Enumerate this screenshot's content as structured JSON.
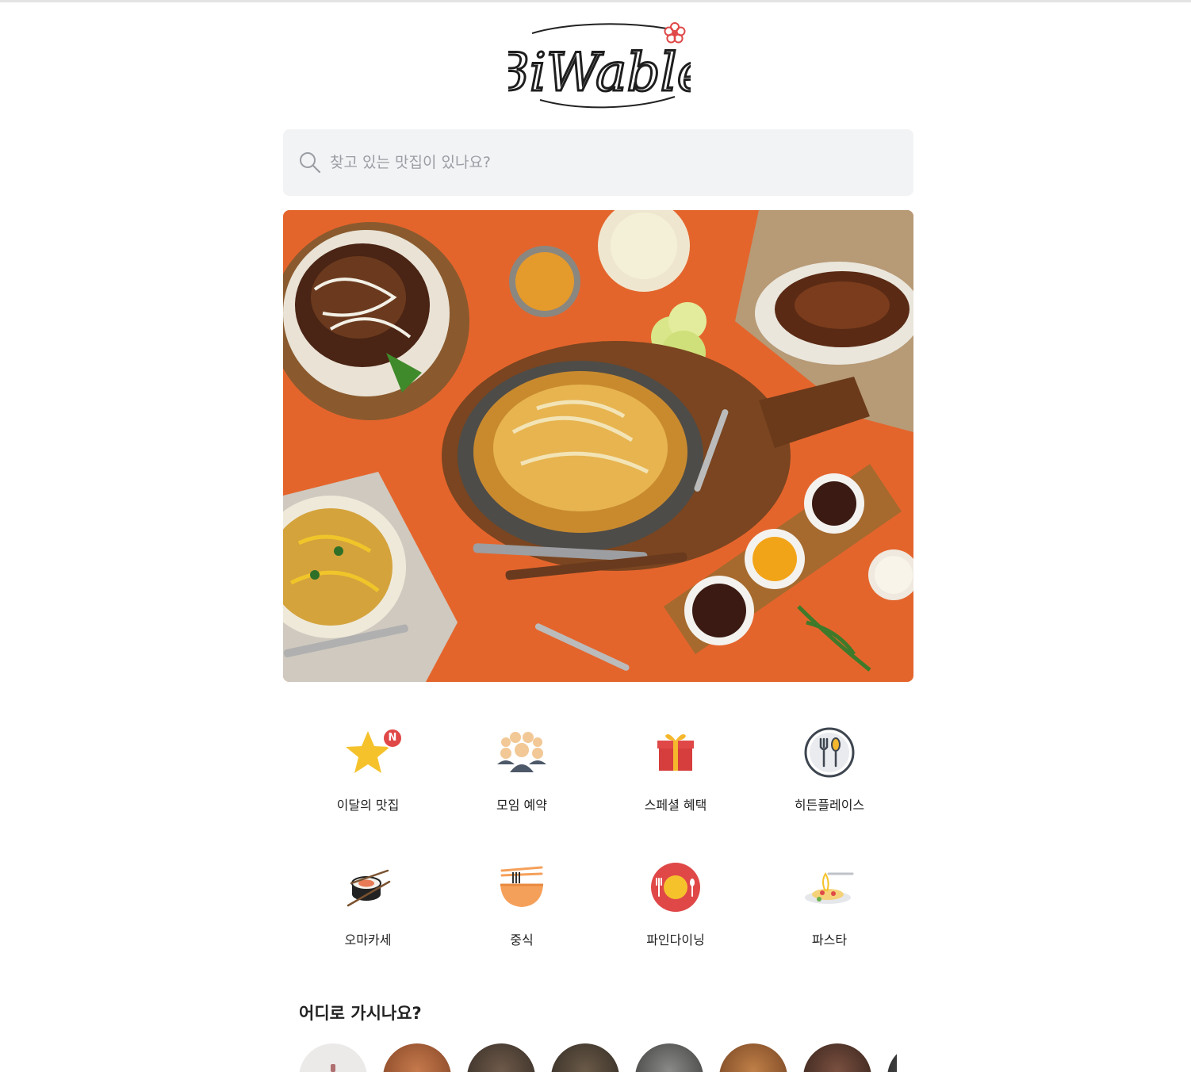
{
  "logo": {
    "text": "BiWable"
  },
  "search": {
    "placeholder": "찾고 있는 맛집이 있나요?",
    "value": ""
  },
  "categories": [
    {
      "label": "이달의 맛집",
      "icon": "star-icon",
      "badge": "N",
      "badge_color": "#e04848"
    },
    {
      "label": "모임 예약",
      "icon": "people-group-icon"
    },
    {
      "label": "스페셜 혜택",
      "icon": "gift-icon"
    },
    {
      "label": "히든플레이스",
      "icon": "fork-spoon-icon"
    },
    {
      "label": "오마카세",
      "icon": "sushi-icon"
    },
    {
      "label": "중식",
      "icon": "noodle-bowl-icon"
    },
    {
      "label": "파인다이닝",
      "icon": "fine-dining-plate-icon"
    },
    {
      "label": "파스타",
      "icon": "pasta-icon"
    }
  ],
  "regions": {
    "title": "어디로 가시나요?"
  },
  "colors": {
    "brand_red": "#e04848",
    "search_bg": "#f2f3f5",
    "hero_bg": "#e8692f"
  }
}
